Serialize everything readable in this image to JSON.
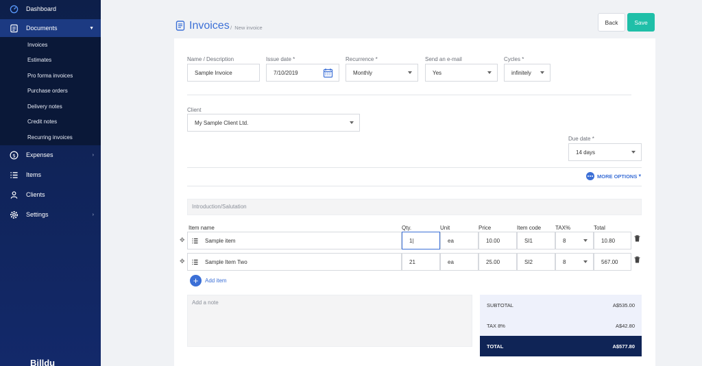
{
  "sidebar": {
    "items": [
      {
        "label": "Dashboard"
      },
      {
        "label": "Documents"
      },
      {
        "label": "Expenses"
      },
      {
        "label": "Items"
      },
      {
        "label": "Clients"
      },
      {
        "label": "Settings"
      }
    ],
    "documents_sub": [
      {
        "label": "Invoices"
      },
      {
        "label": "Estimates"
      },
      {
        "label": "Pro forma invoices"
      },
      {
        "label": "Purchase orders"
      },
      {
        "label": "Delivery notes"
      },
      {
        "label": "Credit notes"
      },
      {
        "label": "Recurring invoices"
      }
    ],
    "brand": "Billdu"
  },
  "header": {
    "title": "Invoices",
    "breadcrumb_sep": "/",
    "breadcrumb": "New invoice",
    "back_label": "Back",
    "save_label": "Save"
  },
  "form": {
    "name_label": "Name / Description",
    "name_value": "Sample Invoice",
    "issue_label": "Issue date *",
    "issue_value": "7/10/2019",
    "recurrence_label": "Recurrence *",
    "recurrence_value": "Monthly",
    "email_label": "Send an e-mail",
    "email_value": "Yes",
    "cycles_label": "Cycles *",
    "cycles_value": "infinitely",
    "client_label": "Client",
    "client_value": "My Sample Client Ltd.",
    "due_label": "Due date *",
    "due_value": "14 days",
    "more_options": "MORE OPTIONS",
    "intro_placeholder": "Introduction/Salutation",
    "note_placeholder": "Add a note",
    "add_item": "Add item"
  },
  "table": {
    "headers": {
      "name": "Item name",
      "qty": "Qty.",
      "unit": "Unit",
      "price": "Price",
      "code": "Item code",
      "tax": "TAX%",
      "total": "Total"
    },
    "rows": [
      {
        "name": "Sample item",
        "qty": "1|",
        "unit": "ea",
        "price": "10.00",
        "code": "SI1",
        "tax": "8",
        "total": "10.80"
      },
      {
        "name": "Sample Item Two",
        "qty": "21",
        "unit": "ea",
        "price": "25.00",
        "code": "SI2",
        "tax": "8",
        "total": "567.00"
      }
    ]
  },
  "totals": {
    "subtotal_label": "SUBTOTAL",
    "subtotal_value": "A$535.00",
    "tax_label": "TAX 8%",
    "tax_value": "A$42.80",
    "total_label": "TOTAL",
    "total_value": "A$577.80"
  },
  "colors": {
    "accent": "#3b6fd6",
    "save": "#1fbfa8",
    "sidebar": "#13296a"
  }
}
